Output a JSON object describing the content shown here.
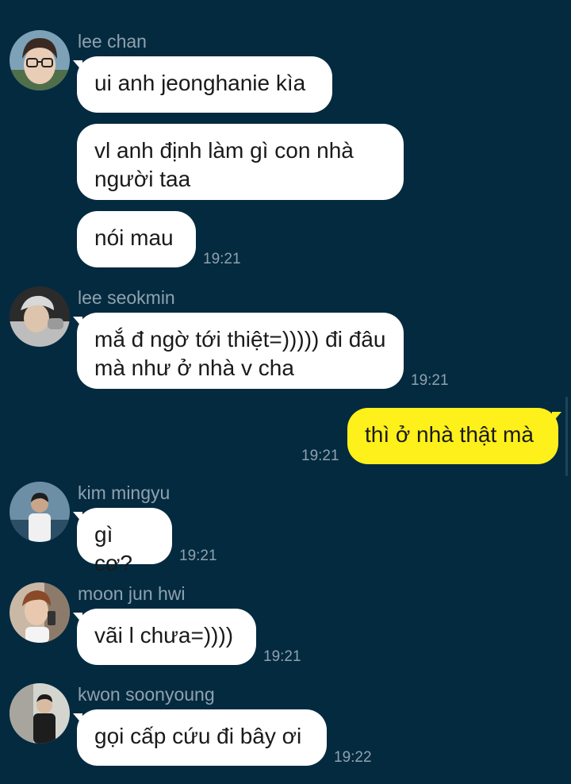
{
  "messages": [
    {
      "sender": "lee chan",
      "bubbles": [
        "ui anh jeonghanie kìa",
        "vl anh định làm gì con nhà người taa",
        "nói mau"
      ],
      "time": "19:21"
    },
    {
      "sender": "lee seokmin",
      "bubbles": [
        "mắ đ ngờ tới thiệt=))))) đi đâu mà như ở nhà v cha"
      ],
      "time": "19:21"
    },
    {
      "sender": "",
      "bubbles": [
        "thì ở nhà thật mà"
      ],
      "time": "19:21"
    },
    {
      "sender": "kim mingyu",
      "bubbles": [
        "gì cơ?"
      ],
      "time": "19:21"
    },
    {
      "sender": "moon jun hwi",
      "bubbles": [
        "vãi l chưa=))))"
      ],
      "time": "19:21"
    },
    {
      "sender": "kwon soonyoung",
      "bubbles": [
        "gọi cấp cứu đi bây ơi"
      ],
      "time": "19:22"
    }
  ],
  "colors": {
    "background": "#042a40",
    "incoming_bubble": "#ffffff",
    "outgoing_bubble": "#fef01b",
    "meta_text": "#8fa1ad"
  }
}
